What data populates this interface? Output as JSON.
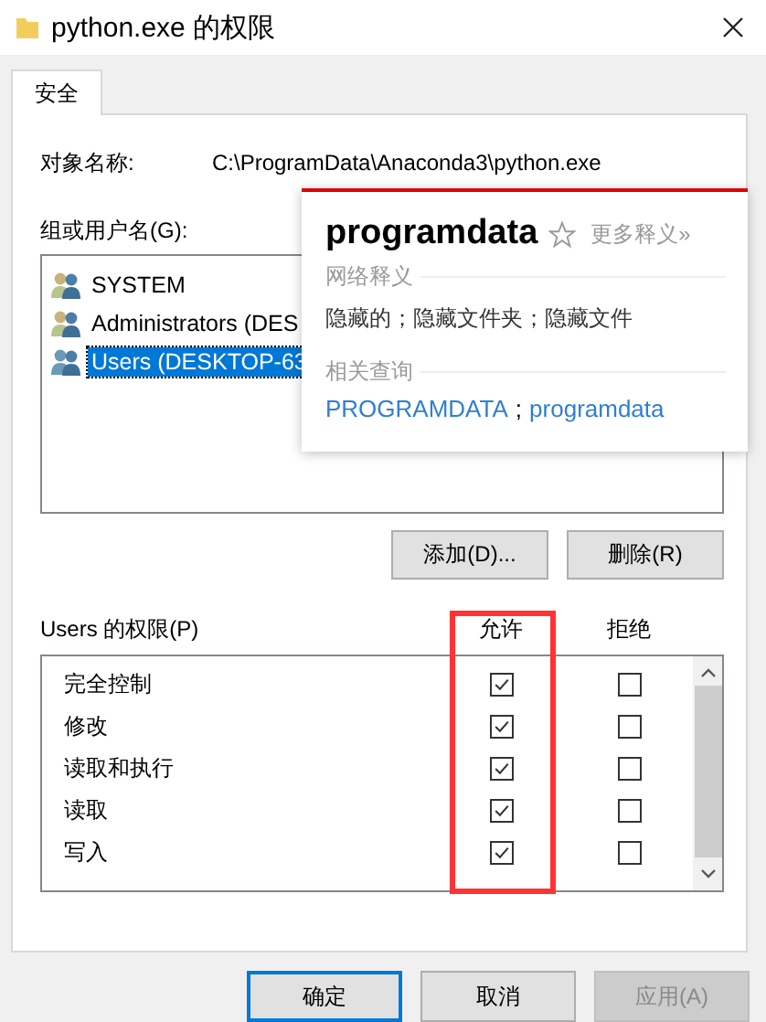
{
  "window": {
    "title": "python.exe 的权限"
  },
  "tabs": [
    {
      "label": "安全",
      "selected": true
    }
  ],
  "object_name": {
    "label": "对象名称:",
    "value": "C:\\ProgramData\\Anaconda3\\python.exe"
  },
  "groups": {
    "label": "组或用户名(G):",
    "items": [
      {
        "name": "SYSTEM",
        "selected": false
      },
      {
        "name": "Administrators (DES",
        "selected": false
      },
      {
        "name": "Users (DESKTOP-63",
        "selected": true
      }
    ],
    "buttons": [
      "添加(D)...",
      "删除(R)"
    ]
  },
  "permissions": {
    "label": "Users 的权限(P)",
    "columns": [
      "允许",
      "拒绝"
    ],
    "rows": [
      {
        "name": "完全控制",
        "allow": true,
        "deny": false
      },
      {
        "name": "修改",
        "allow": true,
        "deny": false
      },
      {
        "name": "读取和执行",
        "allow": true,
        "deny": false
      },
      {
        "name": "读取",
        "allow": true,
        "deny": false
      },
      {
        "name": "写入",
        "allow": true,
        "deny": false
      }
    ]
  },
  "dictionary_popup": {
    "word": "programdata",
    "more": "更多释义»",
    "sections": [
      {
        "heading": "网络释义",
        "kind": "text",
        "items": [
          "隐藏的；隐藏文件夹；隐藏文件"
        ]
      },
      {
        "heading": "相关查询",
        "kind": "links",
        "separator": ";",
        "items": [
          "PROGRAMDATA",
          "programdata"
        ]
      }
    ]
  },
  "footer_buttons": [
    {
      "label": "确定",
      "disabled": false,
      "default": true
    },
    {
      "label": "取消",
      "disabled": false,
      "default": false
    },
    {
      "label": "应用(A)",
      "disabled": true,
      "default": false
    }
  ]
}
